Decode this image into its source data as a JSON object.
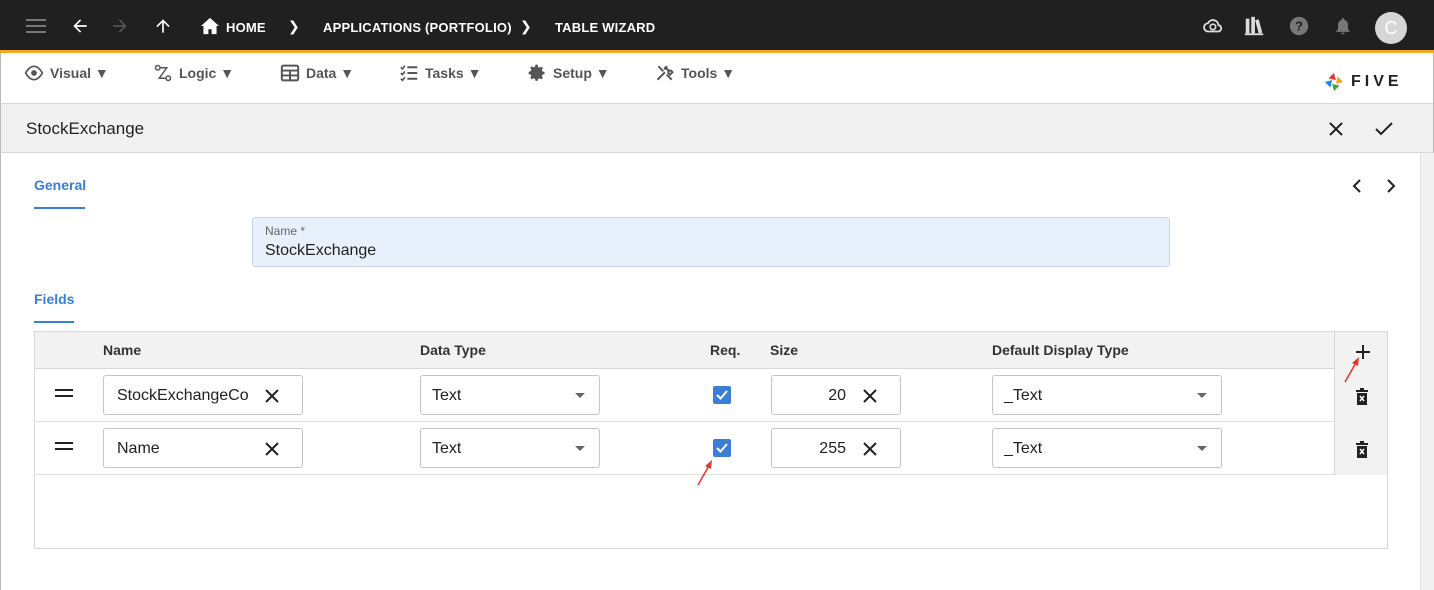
{
  "appbar": {
    "breadcrumbs": [
      "HOME",
      "APPLICATIONS (PORTFOLIO)",
      "TABLE WIZARD"
    ],
    "avatar_initial": "C"
  },
  "menu": {
    "items": [
      {
        "label": "Visual",
        "icon": "eye-icon"
      },
      {
        "label": "Logic",
        "icon": "logic-icon"
      },
      {
        "label": "Data",
        "icon": "table-icon"
      },
      {
        "label": "Tasks",
        "icon": "tasks-icon"
      },
      {
        "label": "Setup",
        "icon": "gear-icon"
      },
      {
        "label": "Tools",
        "icon": "tools-icon"
      }
    ],
    "caret": "▼",
    "logo_text": "FIVE"
  },
  "form": {
    "title": "StockExchange",
    "tab_general": "General",
    "name_label": "Name *",
    "name_value": "StockExchange",
    "tab_fields": "Fields"
  },
  "grid": {
    "headers": {
      "name": "Name",
      "data_type": "Data Type",
      "req": "Req.",
      "size": "Size",
      "display_type": "Default Display Type"
    },
    "rows": [
      {
        "name": "StockExchangeCo",
        "data_type": "Text",
        "required": true,
        "size": "20",
        "display_type": "_Text"
      },
      {
        "name": "Name",
        "data_type": "Text",
        "required": true,
        "size": "255",
        "display_type": "_Text"
      }
    ]
  },
  "colors": {
    "accent": "#3a7fd5",
    "appbar": "#202020",
    "appbar_border": "#f5a623",
    "annotation": "#e53935"
  }
}
